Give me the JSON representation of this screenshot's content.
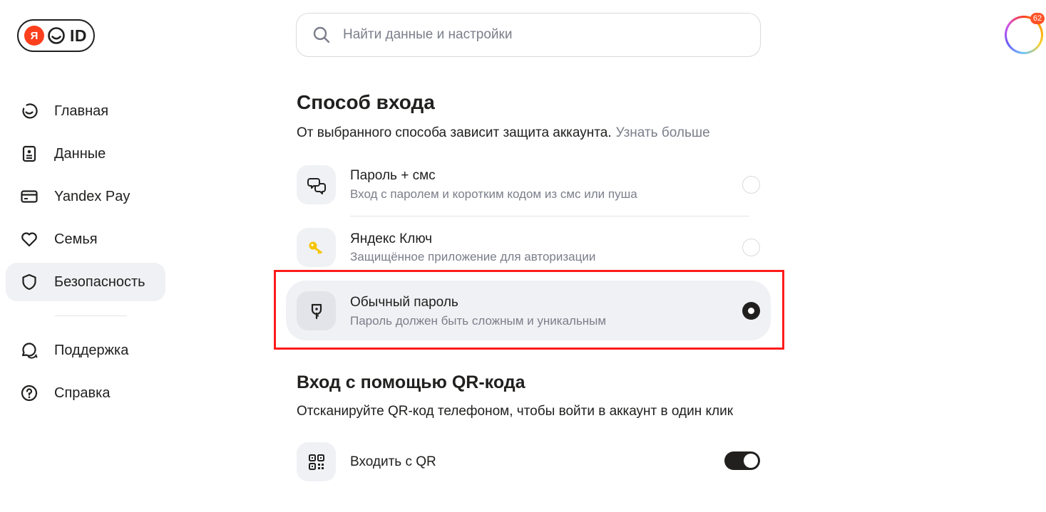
{
  "logo": {
    "letter": "Я",
    "text": "ID"
  },
  "search": {
    "placeholder": "Найти данные и настройки"
  },
  "avatar": {
    "badge": "62"
  },
  "sidebar": {
    "items": [
      {
        "label": "Главная",
        "icon": "home-icon"
      },
      {
        "label": "Данные",
        "icon": "id-card-icon"
      },
      {
        "label": "Yandex Pay",
        "icon": "card-icon"
      },
      {
        "label": "Семья",
        "icon": "heart-icon"
      },
      {
        "label": "Безопасность",
        "icon": "shield-icon",
        "active": true
      },
      {
        "label": "Поддержка",
        "icon": "chat-icon"
      },
      {
        "label": "Справка",
        "icon": "help-icon"
      }
    ]
  },
  "login_method": {
    "title": "Способ входа",
    "subtitle": "От выбранного способа зависит защита аккаунта.",
    "learn_more": "Узнать больше",
    "options": [
      {
        "title": "Пароль + смс",
        "description": "Вход с паролем и коротким кодом из смс или пуша",
        "icon": "sms-icon",
        "selected": false
      },
      {
        "title": "Яндекс Ключ",
        "description": "Защищённое приложение для авторизации",
        "icon": "key-icon",
        "selected": false
      },
      {
        "title": "Обычный пароль",
        "description": "Пароль должен быть сложным и уникальным",
        "icon": "password-icon",
        "selected": true
      }
    ]
  },
  "qr": {
    "title": "Вход с помощью QR-кода",
    "subtitle": "Отсканируйте QR-код телефоном, чтобы войти в аккаунт в один клик",
    "toggle_label": "Входить с QR",
    "toggle_on": true
  },
  "colors": {
    "accent_red": "#fc3f1d",
    "highlight_border": "#ff1b1b",
    "text_primary": "#21201f",
    "text_secondary": "#7b7e8a",
    "selected_bg": "#f0f1f4"
  }
}
